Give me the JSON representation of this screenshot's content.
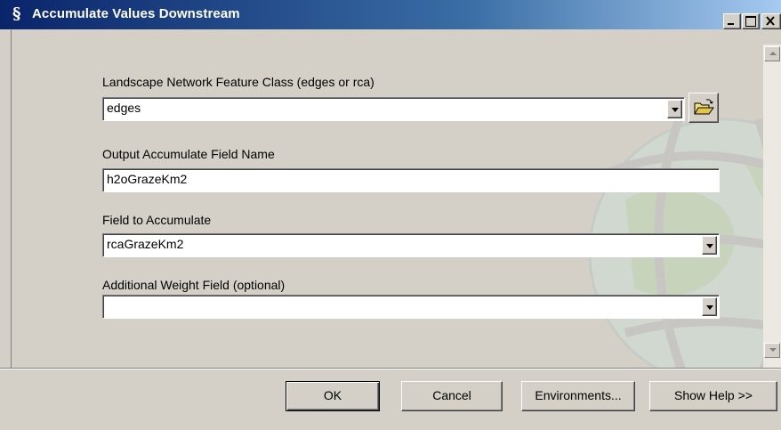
{
  "window": {
    "title": "Accumulate Values Downstream",
    "app_icon": "§",
    "controls": {
      "minimize": "_",
      "maximize": "□",
      "close": "×"
    }
  },
  "form": {
    "landscape_network": {
      "label": "Landscape Network Feature Class (edges or rca)",
      "value": "edges",
      "browse_icon": "open-folder-icon"
    },
    "output_field": {
      "label": "Output Accumulate Field Name",
      "value": "h2oGrazeKm2"
    },
    "field_to_accumulate": {
      "label": "Field to Accumulate",
      "value": "rcaGrazeKm2"
    },
    "weight_field": {
      "label": "Additional Weight Field  (optional)",
      "value": ""
    }
  },
  "buttons": {
    "ok": "OK",
    "cancel": "Cancel",
    "environments": "Environments...",
    "show_help": "Show Help >>"
  },
  "colors": {
    "titlebar_start": "#0a246a",
    "titlebar_end": "#a6caf0",
    "dialog_face": "#d4d0c8"
  }
}
